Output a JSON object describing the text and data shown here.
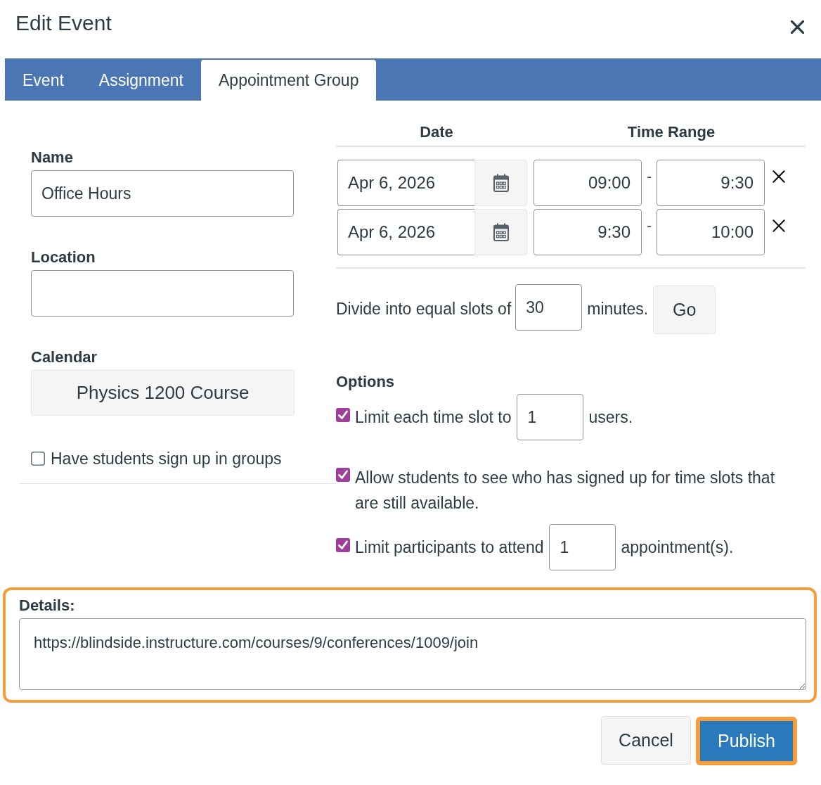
{
  "dialog": {
    "title": "Edit Event"
  },
  "tabs": [
    {
      "label": "Event",
      "selected": false
    },
    {
      "label": "Assignment",
      "selected": false
    },
    {
      "label": "Appointment Group",
      "selected": true
    }
  ],
  "fields": [
    {
      "kind": "text",
      "label": "Name",
      "value": "Office Hours"
    },
    {
      "kind": "text",
      "label": "Location"
    },
    {
      "kind": "button",
      "label": "Calendar",
      "value": "Physics 1200 Course"
    }
  ],
  "group_signup": {
    "label": "Have students sign up in groups",
    "checked": false
  },
  "time_slots": {
    "date_heading": "Date",
    "time_heading": "Time Range",
    "rows": [
      {
        "date": "Apr 6, 2026",
        "start": "09:00",
        "separator": "-",
        "end": "9:30"
      },
      {
        "date": "Apr 6, 2026",
        "start": "9:30",
        "separator": "-",
        "end": "10:00"
      }
    ]
  },
  "divide": {
    "label": "Divide into equal slots of",
    "value": "30",
    "unit": "minutes.",
    "button": "Go"
  },
  "options": {
    "title": "Options",
    "items": [
      {
        "kind": "input",
        "checked": true,
        "label": "Limit each time slot to",
        "value": "1",
        "unit": "users."
      },
      {
        "kind": "text",
        "checked": true,
        "label": "Allow students to see who has signed up for time slots that are still available."
      },
      {
        "kind": "input",
        "checked": true,
        "label": "Limit participants to attend",
        "value": "1",
        "unit": "appointment(s)."
      }
    ]
  },
  "details": {
    "label": "Details:",
    "value": "https://blindside.instructure.com/courses/9/conferences/1009/join",
    "highlighted": true
  },
  "buttons": [
    {
      "kind": "secondary",
      "label": "Cancel",
      "highlighted": false
    },
    {
      "kind": "primary",
      "label": "Publish",
      "highlighted": true
    }
  ]
}
